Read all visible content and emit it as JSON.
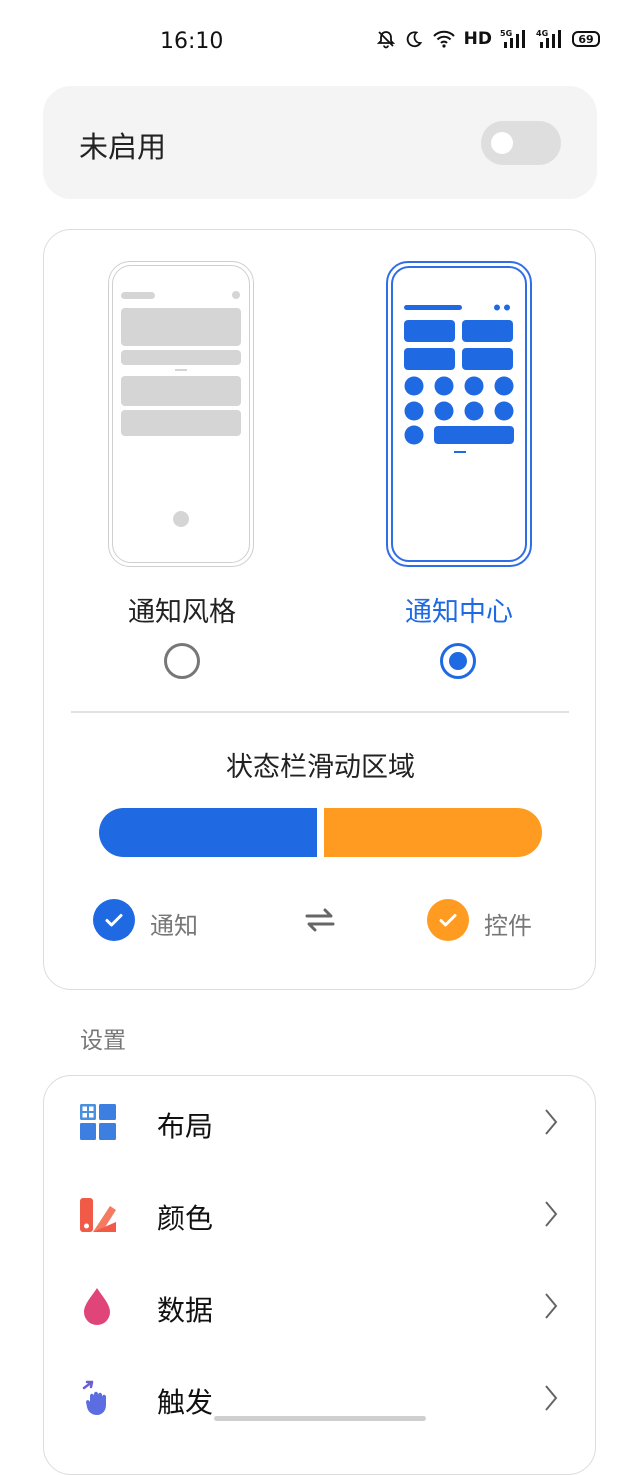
{
  "status_bar": {
    "time": "16:10",
    "icons": [
      "bell-off-icon",
      "moon-icon",
      "wifi-icon",
      "hd-icon",
      "5g-signal-icon",
      "4g-signal-icon",
      "battery-icon"
    ],
    "hd": "HD",
    "battery": "69"
  },
  "toggle": {
    "label": "未启用",
    "state": "off"
  },
  "mode": {
    "left_label": "通知风格",
    "right_label": "通知中心",
    "selected": "right"
  },
  "swipe_area": {
    "title": "状态栏滑动区域",
    "notification_fraction": 0.5,
    "left_label": "通知",
    "right_label": "控件"
  },
  "colors": {
    "blue": "#1f6ae3",
    "orange": "#ff9b21"
  },
  "settings": {
    "section_title": "设置",
    "items": [
      {
        "label": "布局",
        "icon": "layout-icon"
      },
      {
        "label": "颜色",
        "icon": "color-icon"
      },
      {
        "label": "数据",
        "icon": "data-icon"
      },
      {
        "label": "触发",
        "icon": "trigger-icon"
      }
    ]
  }
}
